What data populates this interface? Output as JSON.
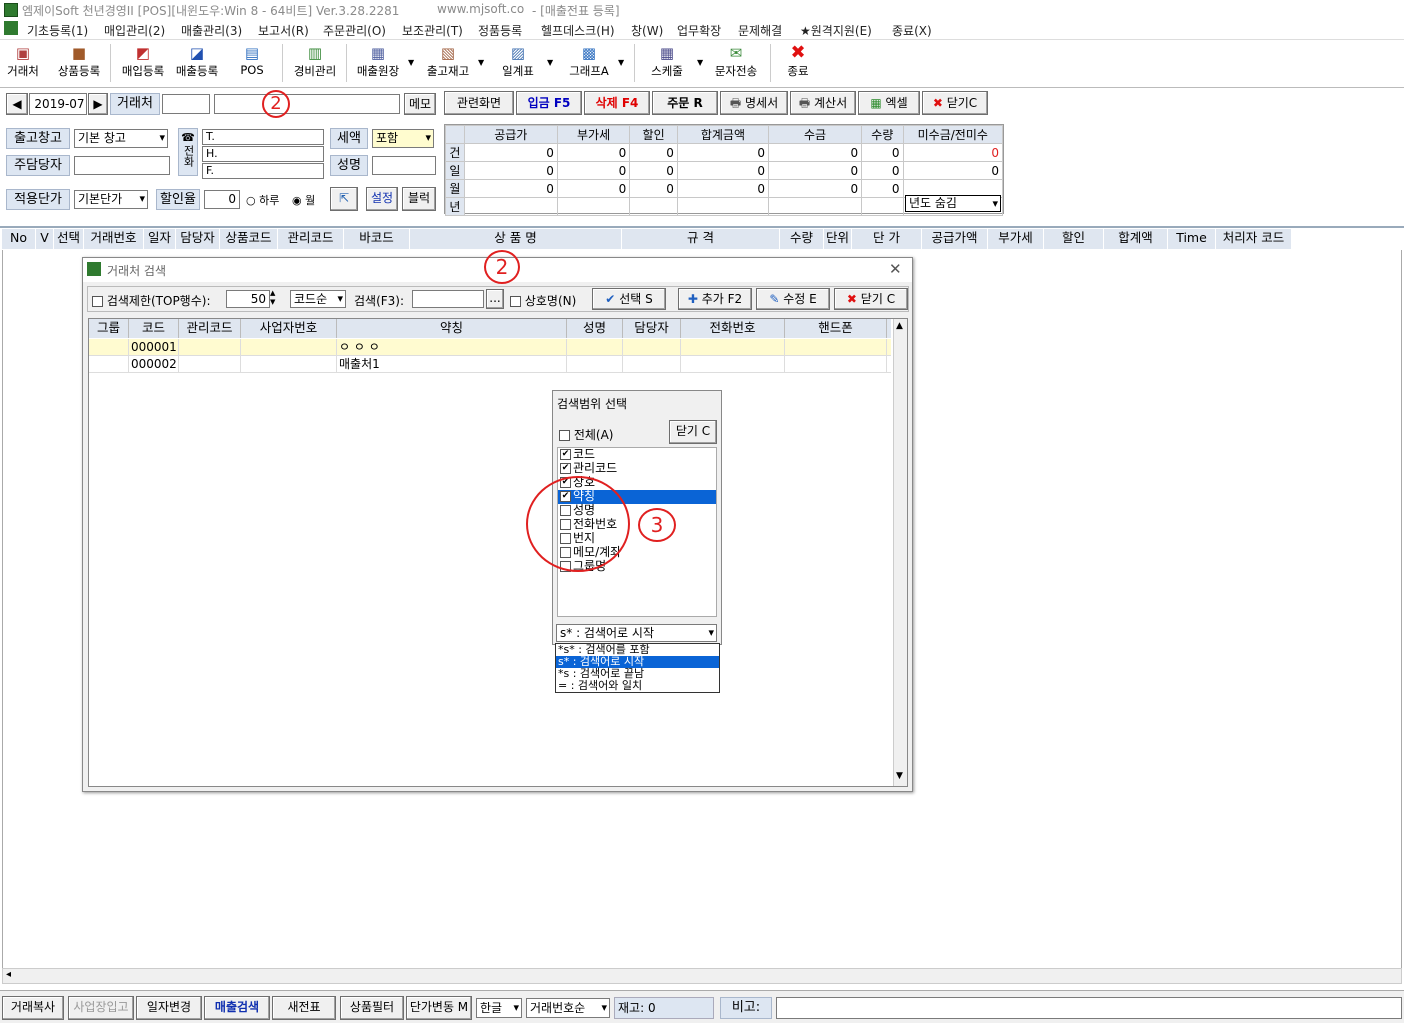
{
  "window": {
    "title": "엠제이Soft 천년경영II [POS][내윈도우:Win 8 - 64비트] Ver.3.28.2281",
    "url": "www.mjsoft.co",
    "doc": "- [매출전표 등록]"
  },
  "menu": [
    "기초등록(1)",
    "매입관리(2)",
    "매출관리(3)",
    "보고서(R)",
    "주문관리(O)",
    "보조관리(T)",
    "정품등록",
    "헬프데스크(H)",
    "창(W)",
    "업무확장",
    "문제해결",
    "★원격지원(E)",
    "종료(X)"
  ],
  "toolbar": [
    {
      "label": "거래처",
      "icon": "people-card-icon"
    },
    {
      "label": "상품등록",
      "icon": "box-icon"
    },
    {
      "label": "매입등록",
      "icon": "purchase-icon"
    },
    {
      "label": "매출등록",
      "icon": "sales-icon"
    },
    {
      "label": "POS",
      "icon": "pos-icon"
    },
    {
      "label": "경비관리",
      "icon": "money-icon"
    },
    {
      "label": "매출원장",
      "icon": "ledger-icon"
    },
    {
      "label": "출고재고",
      "icon": "inventory-icon"
    },
    {
      "label": "일계표",
      "icon": "daily-report-icon"
    },
    {
      "label": "그래프A",
      "icon": "bar-chart-icon"
    },
    {
      "label": "스케줄",
      "icon": "calendar-icon"
    },
    {
      "label": "문자전송",
      "icon": "sms-icon"
    },
    {
      "label": "종료",
      "icon": "close-x-icon"
    }
  ],
  "form": {
    "period": "2019-07",
    "partner_label": "거래처",
    "memo_btn": "메모",
    "warehouse_label": "출고창고",
    "warehouse_value": "기본 창고",
    "manager_label": "주담당자",
    "phone_label": "전화",
    "phone_icon": "☎",
    "t_label": "T.",
    "h_label": "H.",
    "f_label": "F.",
    "tax_label": "세액",
    "tax_value": "포함",
    "name_label": "성명",
    "price_label": "적용단가",
    "price_value": "기본단가",
    "discount_label": "할인율",
    "discount_value": "0",
    "radio_day": "하루",
    "radio_month": "월",
    "setting_btn": "설정",
    "block_btn": "블럭"
  },
  "action_buttons": [
    {
      "label": "관련화면",
      "color": "#000"
    },
    {
      "label": "입금 F5",
      "color": "#0000c0"
    },
    {
      "label": "삭제 F4",
      "color": "#e00000"
    },
    {
      "label": "주문 R",
      "color": "#000"
    },
    {
      "label": "명세서",
      "color": "#000"
    },
    {
      "label": "계산서",
      "color": "#000"
    },
    {
      "label": "엑셀",
      "color": "#000"
    },
    {
      "label": "닫기C",
      "color": "#000"
    }
  ],
  "stats": {
    "headers": [
      "",
      "공급가",
      "부가세",
      "할인",
      "합계금액",
      "수금",
      "수량",
      "미수금/전미수"
    ],
    "rows": [
      {
        "label": "건",
        "vals": [
          "0",
          "0",
          "0",
          "0",
          "0",
          "0",
          "0"
        ]
      },
      {
        "label": "일",
        "vals": [
          "0",
          "0",
          "0",
          "0",
          "0",
          "0",
          "0"
        ]
      },
      {
        "label": "월",
        "vals": [
          "0",
          "0",
          "0",
          "0",
          "0",
          "0",
          ""
        ]
      },
      {
        "label": "년",
        "vals": [
          "",
          "",
          "",
          "",
          "",
          "",
          ""
        ]
      }
    ],
    "year_select": "년도 숨김"
  },
  "grid_headers": [
    "No",
    "V",
    "선택",
    "거래번호",
    "일자",
    "담당자",
    "상품코드",
    "관리코드",
    "바코드",
    "상 품 명",
    "규 격",
    "수량",
    "단위",
    "단 가",
    "공급가액",
    "부가세",
    "할인",
    "합계액",
    "Time",
    "처리자 코드"
  ],
  "dialog": {
    "title": "거래처 검색",
    "limit_label": "검색제한(TOP행수):",
    "limit_value": "50",
    "order_value": "코드순",
    "search_label": "검색(F3):",
    "search_btn": "...",
    "name_chk": "상호명(N)",
    "select_btn": "선택 S",
    "add_btn": "추가 F2",
    "edit_btn": "수정 E",
    "close_btn": "닫기 C",
    "headers": [
      "그룹",
      "코드",
      "관리코드",
      "사업자번호",
      "약칭",
      "성명",
      "담당자",
      "전화번호",
      "핸드폰"
    ],
    "rows": [
      {
        "group": "",
        "code": "000001",
        "mgmt": "",
        "biz": "",
        "short": "ㅇ ㅇ ㅇ",
        "name": "",
        "manager": "",
        "phone": "",
        "mobile": ""
      },
      {
        "group": "",
        "code": "000002",
        "mgmt": "",
        "biz": "",
        "short": "매출처1",
        "name": "",
        "manager": "",
        "phone": "",
        "mobile": ""
      }
    ]
  },
  "popup": {
    "title": "검색범위 선택",
    "all_label": "전체(A)",
    "close_btn": "닫기 C",
    "items": [
      {
        "label": "코드",
        "checked": true
      },
      {
        "label": "관리코드",
        "checked": true
      },
      {
        "label": "상호",
        "checked": true
      },
      {
        "label": "약칭",
        "checked": true
      },
      {
        "label": "성명",
        "checked": false
      },
      {
        "label": "전화번호",
        "checked": false
      },
      {
        "label": "번지",
        "checked": false
      },
      {
        "label": "메모/계좌",
        "checked": false
      },
      {
        "label": "그룹명",
        "checked": false
      }
    ],
    "mode_value": "s* : 검색어로 시작",
    "mode_options": [
      "*s* : 검색어를 포함",
      "s* : 검색어로 시작",
      "*s : 검색어로 끝남",
      "= : 검색어와 일치"
    ]
  },
  "annotations": [
    "2",
    "2",
    "3"
  ],
  "bottom": {
    "buttons": [
      "거래복사",
      "사업장입고",
      "일자변경",
      "매출검색",
      "새전표",
      "상품필터",
      "단가변동 M"
    ],
    "lang": "한글",
    "order": "거래번호순",
    "stock": "재고: 0",
    "note_label": "비고:"
  }
}
